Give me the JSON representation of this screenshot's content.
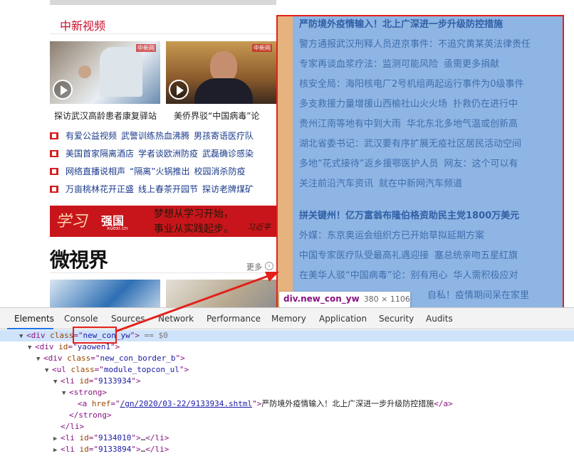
{
  "section_title": "中新视频",
  "videos": [
    {
      "caption": "探访武汉高龄患者康复驿站"
    },
    {
      "caption": "美侨界驳“中国病毒”论"
    }
  ],
  "video_links": [
    [
      "有爱公益视频",
      "武警训练热血沸腾",
      "男孩寄语医疗队"
    ],
    [
      "美国首家隔离酒店",
      "学者谈欧洲防疫",
      "武磊确诊感染"
    ],
    [
      "网络直播说相声",
      "“隔离”火锅推出",
      "校园消杀防疫"
    ],
    [
      "万亩桃林花开正盛",
      "线上春茶开园节",
      "探访老牌煤矿"
    ]
  ],
  "banner": {
    "brand1": "学习",
    "brand2": "强国",
    "site": "xuexi.cn",
    "slogan_line1": "梦想从学习开始，",
    "slogan_line2": "事业从实践起步。",
    "signature": "习近平"
  },
  "micro_video": {
    "logo": "微視界",
    "more": "更多"
  },
  "news": {
    "group1": [
      {
        "items": [
          "严防境外疫情输入！北上广深进一步升级防控措施"
        ],
        "head": true
      },
      {
        "items": [
          "警方通报武汉刑释人员进京事件：不追究黄某英法律责任"
        ]
      },
      {
        "items": [
          "专家再谈血浆疗法：监测可能风险",
          "亟需更多捐献"
        ]
      },
      {
        "items": [
          "核安全局：海阳核电厂2号机组两起运行事件为0级事件"
        ]
      },
      {
        "items": [
          "多支救援力量增援山西榆社山火火场",
          "扑救仍在进行中"
        ]
      },
      {
        "items": [
          "贵州江南等地有中到大雨",
          "华北东北多地气温或创新高"
        ]
      },
      {
        "items": [
          "湖北省委书记：武汉要有序扩展无疫社区居民活动空间"
        ]
      },
      {
        "items": [
          "多地“花式接待”返乡援鄂医护人员",
          "网友：这个可以有"
        ]
      },
      {
        "items": [
          "关注前沿汽车资讯",
          "就在中新网汽车频道"
        ]
      }
    ],
    "group2": [
      {
        "items": [
          "拼关键州！亿万富翁布隆伯格资助民主党1800万美元"
        ],
        "head": true
      },
      {
        "items": [
          "外媒：东京奥运会组织方已开始草拟延期方案"
        ]
      },
      {
        "items": [
          "中国专家医疗队受最高礼遇迎接",
          "塞总统亲吻五星红旗"
        ]
      },
      {
        "items": [
          "在美华人驳“中国病毒”论：别有用心",
          "华人需积极应对"
        ]
      },
      {
        "items": [
          "自私！疫情期间呆在家里"
        ]
      }
    ]
  },
  "tooltip": {
    "name": "div.new_con_yw",
    "dims": "380 × 1106"
  },
  "devtools": {
    "tabs": [
      "Elements",
      "Console",
      "Sources",
      "Network",
      "Performance",
      "Memory",
      "Application",
      "Security",
      "Audits"
    ],
    "selected_suffix": "== $0",
    "node1_class": "new_con_yw",
    "node2_id": "yaowen1",
    "node3_class": "new_con_border_b",
    "node4_class": "module_topcon_ul",
    "node5_id": "9133934",
    "link_href": "/gn/2020/03-22/9133934.shtml",
    "link_text": "严防境外疫情输入！北上广深进一步升级防控措施",
    "node6_id": "9134010",
    "node7_id": "9133894",
    "ellipsis": "…"
  },
  "colors": {
    "accent_red": "#e3201b",
    "highlight_blue": "#6fa0dc",
    "highlight_orange": "#f6b26b",
    "tag_purple": "#881280"
  }
}
